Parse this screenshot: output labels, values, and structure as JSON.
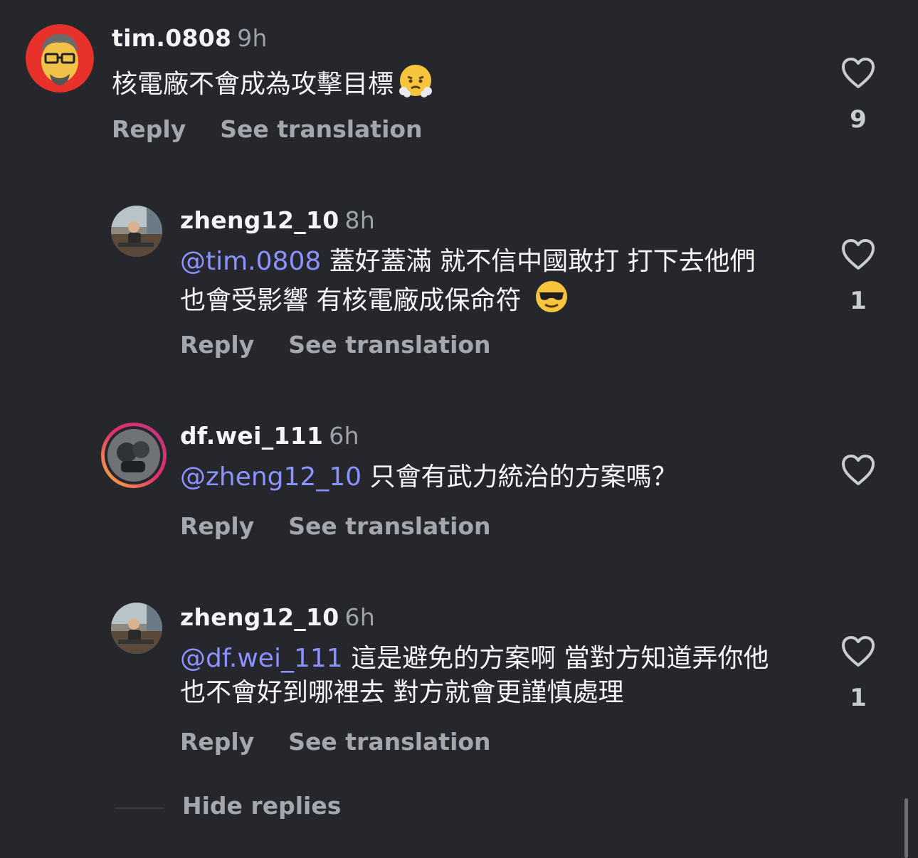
{
  "comments": [
    {
      "username": "tim.0808",
      "time": "9h",
      "mention": "",
      "text": "核電廠不會成為攻擊目標",
      "emoji": "😤",
      "reply_label": "Reply",
      "translation_label": "See translation",
      "likes": "9"
    },
    {
      "username": "zheng12_10",
      "time": "8h",
      "mention": "@tim.0808",
      "text": " 蓋好蓋滿 就不信中國敢打 打下去他們也會受影響 有核電廠成保命符 ",
      "emoji": "😎",
      "reply_label": "Reply",
      "translation_label": "See translation",
      "likes": "1"
    },
    {
      "username": "df.wei_111",
      "time": "6h",
      "mention": "@zheng12_10",
      "text": " 只會有武力統治的方案嗎？",
      "emoji": "",
      "reply_label": "Reply",
      "translation_label": "See translation",
      "likes": ""
    },
    {
      "username": "zheng12_10",
      "time": "6h",
      "mention": "@df.wei_111",
      "text": " 這是避免的方案啊 當對方知道弄你他也不會好到哪裡去 對方就會更謹慎處理",
      "emoji": "",
      "reply_label": "Reply",
      "translation_label": "See translation",
      "likes": "1"
    }
  ],
  "hide_replies_label": "Hide replies",
  "colors": {
    "background": "#25272c",
    "mention": "#8c93ff",
    "secondary_text": "#a4a8ae",
    "story_ring": "#e1306c"
  }
}
